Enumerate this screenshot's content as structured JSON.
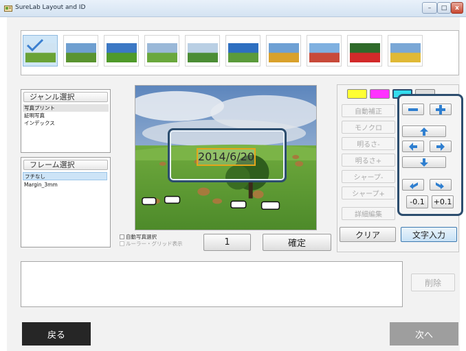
{
  "window": {
    "title": "SureLab Layout and ID",
    "minimize_glyph": "–",
    "maximize_glyph": "□",
    "close_glyph": "x"
  },
  "thumbnails": {
    "count": 11,
    "selected_index": 0,
    "items": [
      {
        "subject": "tree-hill",
        "sky": "#cfe3f2",
        "ground": "#6aa336",
        "selected": true
      },
      {
        "subject": "meadow-clouds",
        "sky": "#6f9fd0",
        "ground": "#5a9430"
      },
      {
        "subject": "green-field-blue-sky",
        "sky": "#3c78c4",
        "ground": "#4f9a2a"
      },
      {
        "subject": "cloudy-field",
        "sky": "#9ab8d8",
        "ground": "#6aa83d"
      },
      {
        "subject": "fields-trees",
        "sky": "#b9cfe4",
        "ground": "#4b8d35"
      },
      {
        "subject": "blue-sky-road",
        "sky": "#2e6fc0",
        "ground": "#5b9b3b"
      },
      {
        "subject": "flower-field",
        "sky": "#6ea0d4",
        "ground": "#d9a12c"
      },
      {
        "subject": "striped-flower-hills",
        "sky": "#7fb0e0",
        "ground": "#c84a3a"
      },
      {
        "subject": "red-flowers",
        "sky": "#2f6a2a",
        "ground": "#d22a2a"
      },
      {
        "subject": "tulip-rows",
        "sky": "#7aa7d6",
        "ground": "#e0b936"
      }
    ]
  },
  "genre": {
    "header": "ジャンル選択",
    "items": [
      "写真プリント",
      "証明写真",
      "インデックス"
    ],
    "selected_index": 0
  },
  "frame": {
    "header": "フレーム選択",
    "items": [
      "フチなし",
      "Margin_3mm"
    ],
    "selected_index": 0
  },
  "preview": {
    "date_text": "2014/6/20"
  },
  "options": {
    "auto_select_label": "自動写真選択",
    "ruler_grid_label": "ルーラー・グリッド表示"
  },
  "counter": {
    "value": "1"
  },
  "confirm_label": "確定",
  "edit": {
    "colors": [
      "#ffff33",
      "#ff33ff",
      "#33ddee",
      "#dddddd"
    ],
    "selected_color_index": 2,
    "buttons": [
      "自動補正",
      "モノクロ",
      "明るさ-",
      "明るさ+",
      "シャープ-",
      "シャープ+",
      "詳細編集"
    ]
  },
  "adjust": {
    "minus_label": "−",
    "plus_label": "+",
    "step_down_label": "-0.1",
    "step_up_label": "+0.1"
  },
  "clear_label": "クリア",
  "text_input_label": "文字入力",
  "delete_label": "削除",
  "back_label": "戻る",
  "next_label": "次へ"
}
